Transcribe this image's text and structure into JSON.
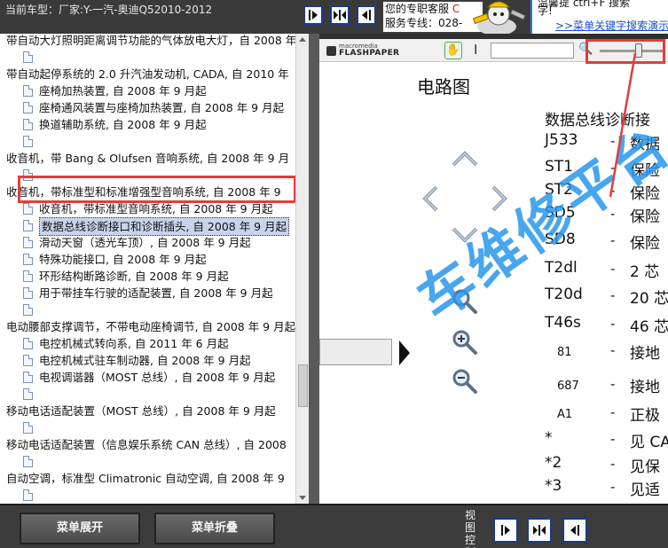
{
  "header": {
    "car_model": "当前车型：厂家:Y-一汽-奥迪Q52010-2012",
    "service_line1": "您的专职客服",
    "service_line1_extra": "C",
    "service_line2": "服务专线：028-",
    "banner_line1": "温馨提 ctrl+F 搜索",
    "banner_line2": "字!",
    "banner_link": ">>菜单关键字搜索演示"
  },
  "tree": {
    "items": [
      {
        "label": "带自动大灯照明距离调节功能的气体放电大灯，自 2008 年",
        "level": 0
      },
      {
        "label": "",
        "level": 1
      },
      {
        "label": "带自动起停系统的 2.0 升汽油发动机, CADA, 自 2010 年",
        "level": 0
      },
      {
        "label": "座椅加热装置, 自 2008 年 9 月起",
        "level": 1
      },
      {
        "label": "座椅通风装置与座椅加热装置, 自 2008 年 9 月起",
        "level": 1
      },
      {
        "label": "换道辅助系统, 自 2008 年 9 月起",
        "level": 1
      },
      {
        "label": "",
        "level": 1
      },
      {
        "label": "收音机，带 Bang & Olufsen 音响系统, 自 2008 年 9 月",
        "level": 0
      },
      {
        "label": "",
        "level": 1
      },
      {
        "label": "收音机，带标准型和标准增强型音响系统, 自 2008 年 9",
        "level": 0
      },
      {
        "label": "收音机，带标准型音响系统, 自 2008 年 9 月起",
        "level": 1
      },
      {
        "label": "数据总线诊断接口和诊断插头, 自 2008 年 9 月起",
        "level": 1,
        "selected": true
      },
      {
        "label": "滑动天窗（透光车顶）, 自 2008 年 9 月起",
        "level": 1
      },
      {
        "label": "特殊功能接口, 自 2008 年 9 月起",
        "level": 1
      },
      {
        "label": "环形结构断路诊断, 自 2008 年 9 月起",
        "level": 1
      },
      {
        "label": "用于带挂车行驶的适配装置, 自 2008 年 9 月起",
        "level": 1
      },
      {
        "label": "",
        "level": 1
      },
      {
        "label": "电动腰部支撑调节，不带电动座椅调节, 自 2008 年 9 月起",
        "level": 0
      },
      {
        "label": "电控机械式转向系, 自 2011 年 6 月起",
        "level": 1
      },
      {
        "label": "电控机械式驻车制动器, 自 2008 年 9 月起",
        "level": 1
      },
      {
        "label": "电视调谐器（MOST 总线）, 自 2008 年 9 月起",
        "level": 1
      },
      {
        "label": "",
        "level": 1
      },
      {
        "label": "移动电话适配装置（MOST 总线）, 自 2008 年 9 月起",
        "level": 0
      },
      {
        "label": "",
        "level": 1
      },
      {
        "label": "移动电话适配装置（信息娱乐系统 CAN 总线）, 自 2008",
        "level": 0
      },
      {
        "label": "",
        "level": 1
      },
      {
        "label": "自动空调，标准型 Climatronic 自动空调, 自 2008 年 9",
        "level": 0
      },
      {
        "label": "",
        "level": 1
      }
    ]
  },
  "viewer": {
    "logo_top": "macromedia",
    "logo_main": "FLASHPAPER",
    "page_heading": "电路图",
    "doc_title": "数据总线诊断接",
    "legend_rows": [
      {
        "abbr": "J533",
        "desc": "数据",
        "small": false
      },
      {
        "abbr": "ST1",
        "desc": "保险",
        "small": false
      },
      {
        "abbr": "ST2",
        "desc": "保险",
        "small": false
      },
      {
        "abbr": "SD5",
        "desc": "保险",
        "small": false
      },
      {
        "abbr": "SD8",
        "desc": "保险",
        "small": false
      },
      {
        "abbr": "T2dl",
        "desc": "2 芯",
        "small": false
      },
      {
        "abbr": "T20d",
        "desc": "20 芯",
        "small": false
      },
      {
        "abbr": "T46s",
        "desc": "46 芯",
        "small": false
      },
      {
        "abbr": "81",
        "desc": "接地",
        "small": true
      },
      {
        "abbr": "687",
        "desc": "接地",
        "small": true
      },
      {
        "abbr": "A1",
        "desc": "正极",
        "small": true
      },
      {
        "abbr": "*",
        "desc": "见 CA",
        "small": false
      },
      {
        "abbr": "*2",
        "desc": "见保",
        "small": false
      },
      {
        "abbr": "*3",
        "desc": "见适",
        "small": false
      }
    ],
    "watermark": "车维修平台"
  },
  "bottom": {
    "expand_label": "菜单展开",
    "collapse_label": "菜单折叠",
    "view_ctrl_label": "视图控制"
  }
}
